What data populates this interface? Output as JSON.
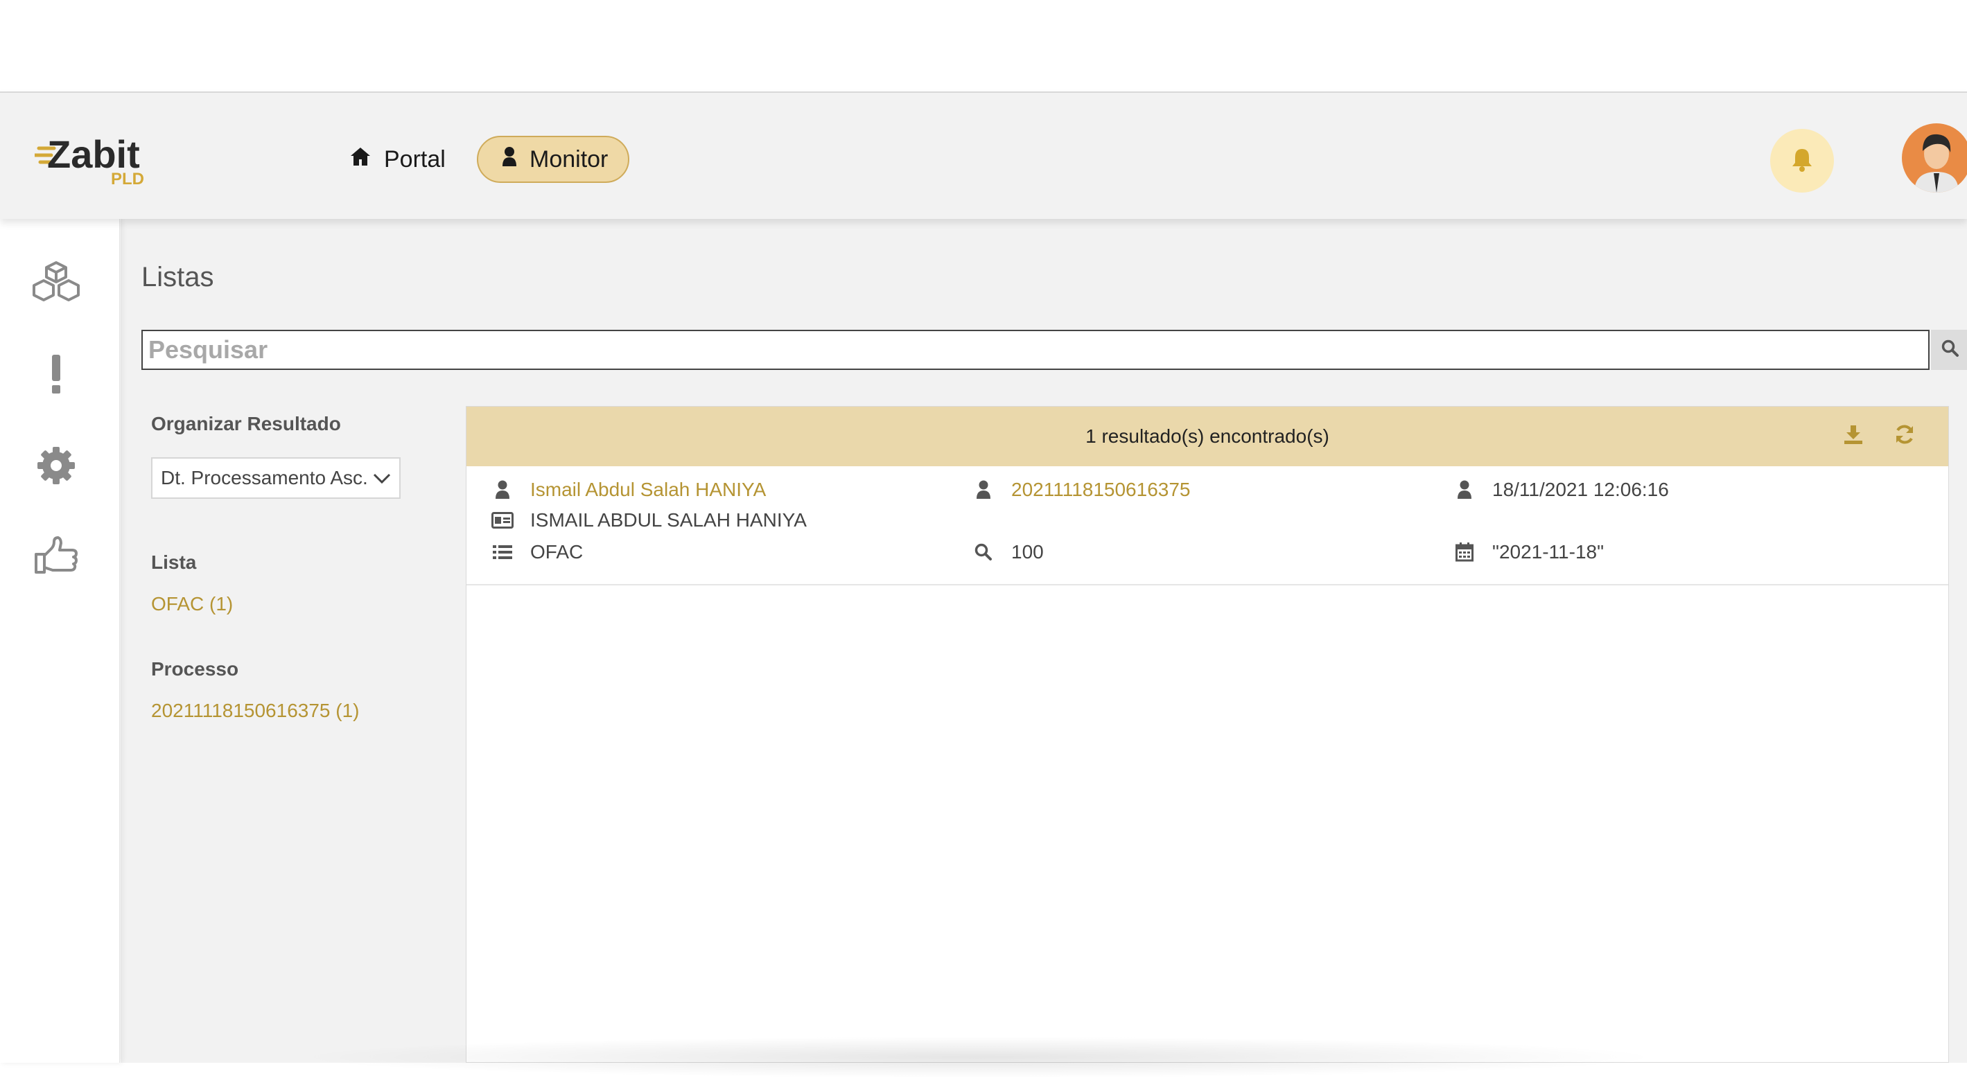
{
  "app": {
    "logo_text": "Zabit",
    "logo_sub": "PLD"
  },
  "nav": {
    "portal_label": "Portal",
    "monitor_label": "Monitor"
  },
  "page": {
    "title": "Listas"
  },
  "search": {
    "placeholder": "Pesquisar"
  },
  "filters": {
    "sort_label": "Organizar Resultado",
    "sort_value": "Dt. Processamento Asc.",
    "lista_label": "Lista",
    "lista_items": [
      "OFAC (1)"
    ],
    "processo_label": "Processo",
    "processo_items": [
      "20211118150616375 (1)"
    ]
  },
  "results": {
    "count_text": "1 resultado(s) encontrado(s)",
    "rows": [
      {
        "name": "Ismail Abdul Salah HANIYA",
        "process_id": "20211118150616375",
        "datetime": "18/11/2021 12:06:16",
        "document_name": "ISMAIL ABDUL SALAH HANIYA",
        "list": "OFAC",
        "score": "100",
        "date": "\"2021-11-18\""
      }
    ]
  },
  "colors": {
    "accent": "#b59433",
    "header_band": "#ead8ab",
    "monitor_bg": "#efd9a6",
    "bell_bg": "#fbeab8"
  },
  "icons": {
    "sidebar": [
      "cubes-icon",
      "exclamation-icon",
      "gear-icon",
      "thumbs-up-icon"
    ],
    "header": [
      "home-icon",
      "user-icon",
      "bell-icon"
    ],
    "results": [
      "download-icon",
      "refresh-icon",
      "user-icon",
      "id-card-icon",
      "list-icon",
      "search-icon",
      "calendar-icon"
    ]
  }
}
